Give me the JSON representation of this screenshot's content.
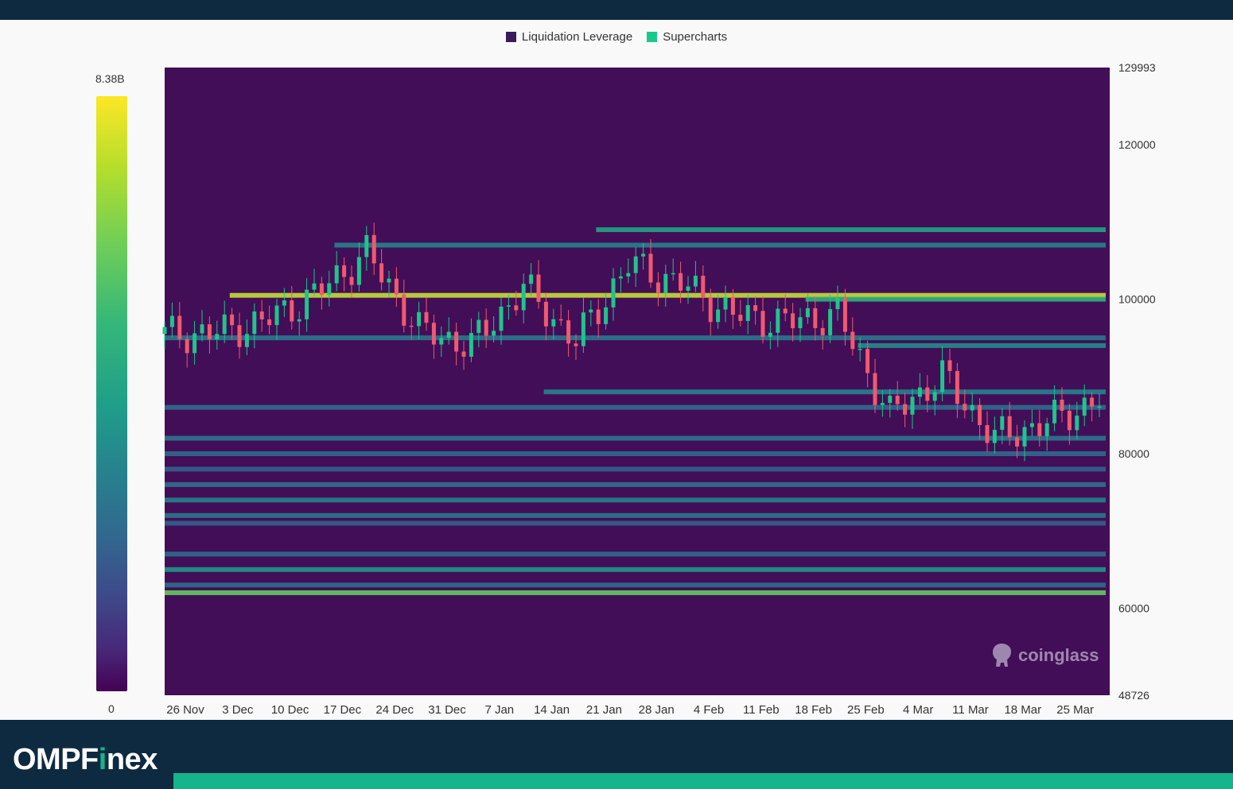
{
  "legend": {
    "items": [
      {
        "label": "Liquidation Leverage",
        "color": "#3b1c5a"
      },
      {
        "label": "Supercharts",
        "color": "#18c98a"
      }
    ]
  },
  "color_scale": {
    "max_label": "8.38B",
    "min_label": "0",
    "colormap": "viridis"
  },
  "watermark": {
    "text": "coinglass",
    "icon": "coinglass-logo-icon"
  },
  "brand": {
    "prefix": "OMPF",
    "accent": "i",
    "suffix": "nex",
    "accent_color": "#15b48a"
  },
  "chart_data": {
    "type": "heatmap",
    "title": "",
    "xlabel": "",
    "ylabel": "",
    "ylim": [
      48726,
      129993
    ],
    "y_ticks": [
      "129993",
      "120000",
      "100000",
      "80000",
      "60000",
      "48726"
    ],
    "x_ticks": [
      "26 Nov",
      "3 Dec",
      "10 Dec",
      "17 Dec",
      "24 Dec",
      "31 Dec",
      "7 Jan",
      "14 Jan",
      "21 Jan",
      "28 Jan",
      "4 Feb",
      "11 Feb",
      "18 Feb",
      "25 Feb",
      "4 Mar",
      "11 Mar",
      "18 Mar",
      "25 Mar"
    ],
    "value_range": [
      0,
      8380000000
    ],
    "series": [
      {
        "name": "Supercharts",
        "type": "candlestick",
        "approx_close_by_week": [
          {
            "x": "26 Nov",
            "close": 95500
          },
          {
            "x": "3 Dec",
            "close": 97000
          },
          {
            "x": "10 Dec",
            "close": 100500
          },
          {
            "x": "17 Dec",
            "close": 106000
          },
          {
            "x": "24 Dec",
            "close": 96000
          },
          {
            "x": "31 Dec",
            "close": 94000
          },
          {
            "x": "7 Jan",
            "close": 101500
          },
          {
            "x": "14 Jan",
            "close": 94500
          },
          {
            "x": "21 Jan",
            "close": 104500
          },
          {
            "x": "28 Jan",
            "close": 102000
          },
          {
            "x": "4 Feb",
            "close": 98000
          },
          {
            "x": "11 Feb",
            "close": 97000
          },
          {
            "x": "18 Feb",
            "close": 98000
          },
          {
            "x": "25 Feb",
            "close": 85000
          },
          {
            "x": "4 Mar",
            "close": 90000
          },
          {
            "x": "11 Mar",
            "close": 82000
          },
          {
            "x": "18 Mar",
            "close": 84000
          },
          {
            "x": "25 Mar",
            "close": 87000
          }
        ],
        "high": 109000,
        "low": 77000
      }
    ],
    "liquidation_levels": [
      {
        "price": 109000,
        "from": "21 Jan",
        "intensity": 0.65
      },
      {
        "price": 107000,
        "from": "17 Dec",
        "intensity": 0.5
      },
      {
        "price": 100500,
        "from": "3 Dec",
        "intensity": 0.95
      },
      {
        "price": 100000,
        "from": "18 Feb",
        "intensity": 0.72
      },
      {
        "price": 95000,
        "from": "26 Nov",
        "intensity": 0.45
      },
      {
        "price": 94000,
        "from": "25 Feb",
        "intensity": 0.55
      },
      {
        "price": 88000,
        "from": "14 Jan",
        "intensity": 0.5
      },
      {
        "price": 86000,
        "from": "26 Nov",
        "intensity": 0.4
      },
      {
        "price": 82000,
        "from": "26 Nov",
        "intensity": 0.45
      },
      {
        "price": 80000,
        "from": "26 Nov",
        "intensity": 0.4
      },
      {
        "price": 78000,
        "from": "26 Nov",
        "intensity": 0.35
      },
      {
        "price": 76000,
        "from": "26 Nov",
        "intensity": 0.42
      },
      {
        "price": 74000,
        "from": "26 Nov",
        "intensity": 0.5
      },
      {
        "price": 72000,
        "from": "26 Nov",
        "intensity": 0.45
      },
      {
        "price": 71000,
        "from": "26 Nov",
        "intensity": 0.35
      },
      {
        "price": 67000,
        "from": "26 Nov",
        "intensity": 0.4
      },
      {
        "price": 65000,
        "from": "26 Nov",
        "intensity": 0.58
      },
      {
        "price": 63000,
        "from": "26 Nov",
        "intensity": 0.4
      },
      {
        "price": 62000,
        "from": "26 Nov",
        "intensity": 0.85
      }
    ]
  }
}
